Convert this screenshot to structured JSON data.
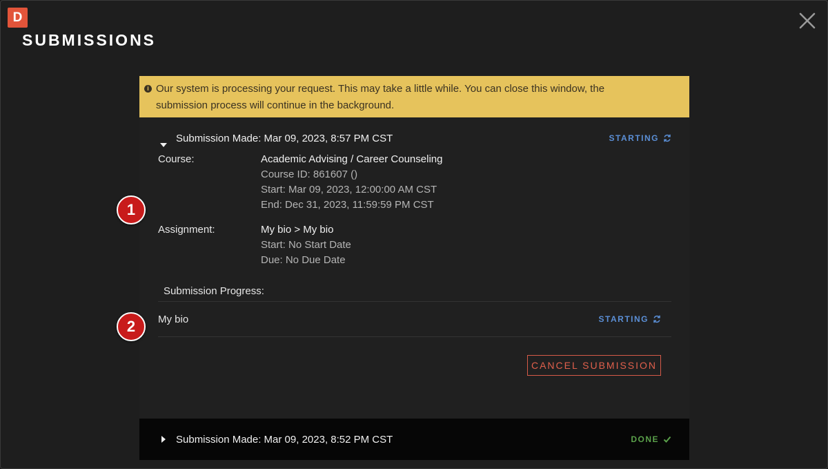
{
  "app": {
    "logo_letter": "D",
    "title": "SUBMISSIONS"
  },
  "notice": {
    "line1": "Our system is processing your request. This may take a little while. You can close this window, the",
    "line2": "submission process will continue in the background."
  },
  "submissions": [
    {
      "header": "Submission Made: Mar 09, 2023, 8:57 PM CST",
      "status": "STARTING",
      "course_label": "Course:",
      "course_name": "Academic Advising / Career Counseling",
      "course_id": "Course ID: 861607 ()",
      "course_start": "Start: Mar 09, 2023, 12:00:00 AM CST",
      "course_end": "End: Dec 31, 2023, 11:59:59 PM CST",
      "assignment_label": "Assignment:",
      "assignment_name": "My bio > My bio",
      "assignment_start": "Start: No Start Date",
      "assignment_due": "Due: No Due Date",
      "progress_title": "Submission Progress:",
      "progress_item": "My bio",
      "progress_status": "STARTING",
      "cancel_label": "CANCEL SUBMISSION"
    },
    {
      "header": "Submission Made: Mar 09, 2023, 8:52 PM CST",
      "status": "DONE"
    }
  ],
  "annotations": [
    "1",
    "2"
  ],
  "colors": {
    "notice_bg": "#e6c35c",
    "starting": "#5b8fd6",
    "done": "#5aa04a",
    "cancel": "#e0604c",
    "badge": "#c81b1b"
  }
}
